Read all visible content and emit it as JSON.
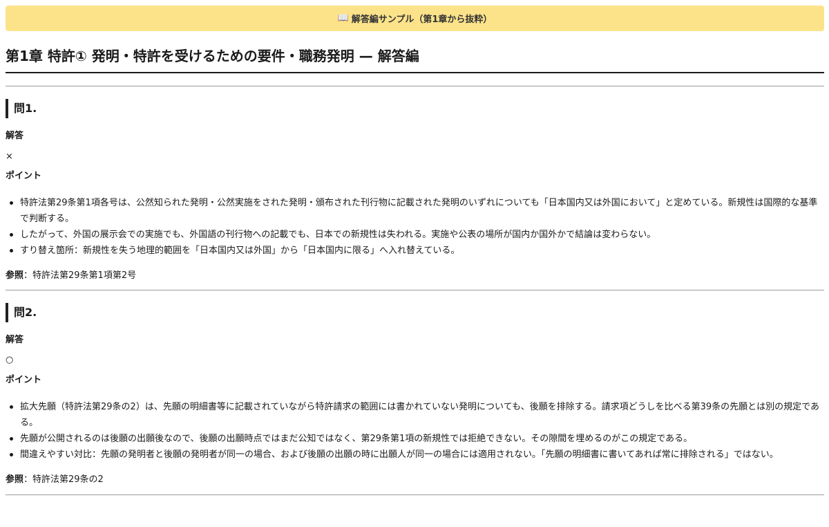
{
  "banner": {
    "icon": "book-icon",
    "icon_glyph": "📖",
    "text": "解答編サンプル（第1章から抜粋）"
  },
  "title": "第1章 特許① 発明・特許を受けるための要件・職務発明 — 解答編",
  "questions": [
    {
      "heading": "問1.",
      "answer_label": "解答",
      "answer": "×",
      "points_label": "ポイント",
      "points": [
        "特許法第29条第1項各号は、公然知られた発明・公然実施をされた発明・頒布された刊行物に記載された発明のいずれについても「日本国内又は外国において」と定めている。新規性は国際的な基準で判断する。",
        "したがって、外国の展示会での実施でも、外国語の刊行物への記載でも、日本での新規性は失われる。実施や公表の場所が国内か国外かで結論は変わらない。",
        "すり替え箇所：新規性を失う地理的範囲を「日本国内又は外国」から「日本国内に限る」へ入れ替えている。"
      ],
      "ref_label": "参照",
      "ref_text": "：特許法第29条第1項第2号"
    },
    {
      "heading": "問2.",
      "answer_label": "解答",
      "answer": "○",
      "points_label": "ポイント",
      "points": [
        "拡大先願（特許法第29条の2）は、先願の明細書等に記載されていながら特許請求の範囲には書かれていない発明についても、後願を排除する。請求項どうしを比べる第39条の先願とは別の規定である。",
        "先願が公開されるのは後願の出願後なので、後願の出願時点ではまだ公知ではなく、第29条第1項の新規性では拒絶できない。その隙間を埋めるのがこの規定である。",
        "間違えやすい対比：先願の発明者と後願の発明者が同一の場合、および後願の出願の時に出願人が同一の場合には適用されない。「先願の明細書に書いてあれば常に排除される」ではない。"
      ],
      "ref_label": "参照",
      "ref_text": "：特許法第29条の2"
    }
  ]
}
